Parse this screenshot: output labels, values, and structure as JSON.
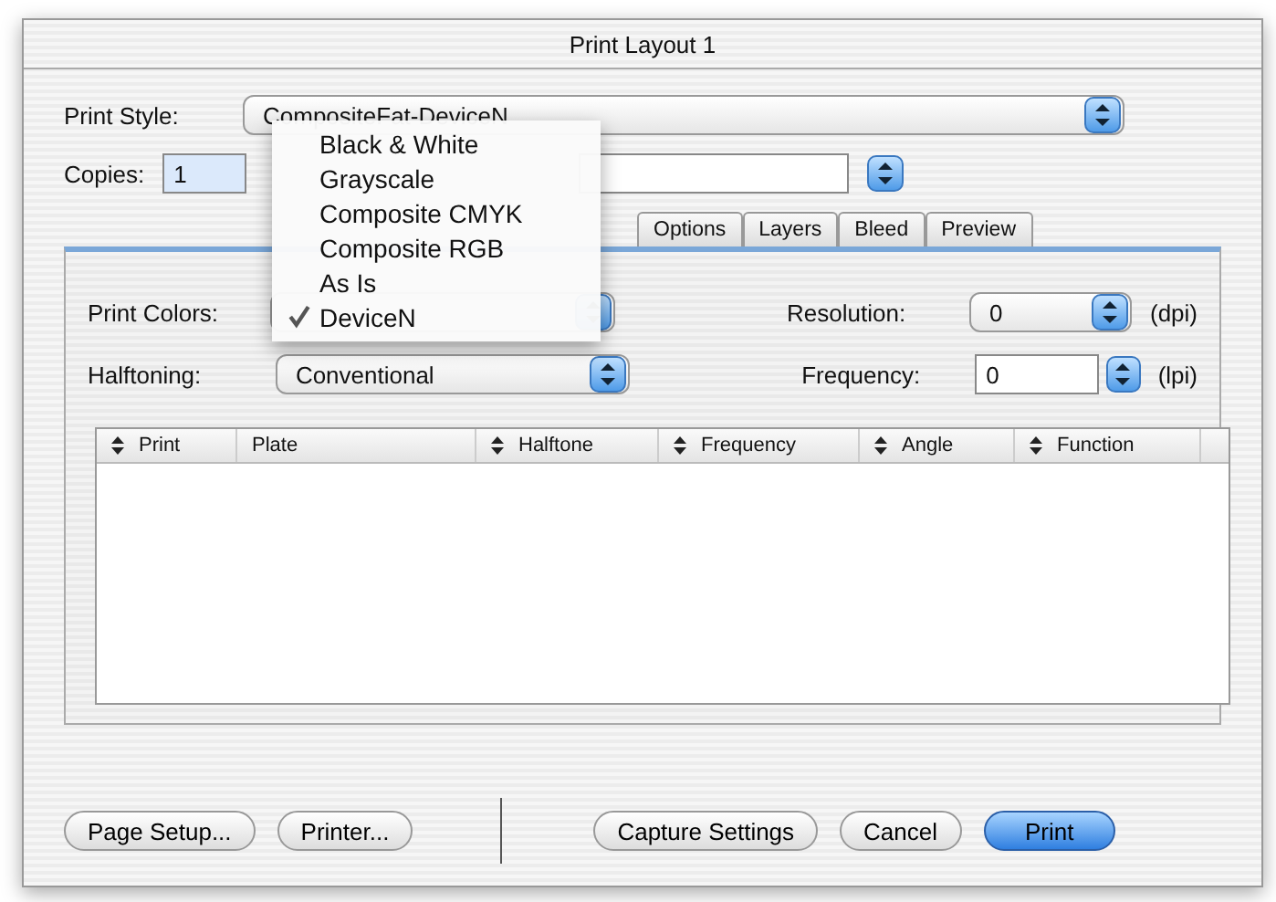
{
  "window": {
    "title": "Print Layout 1"
  },
  "print_style": {
    "label": "Print Style:",
    "value": "CompositeFat-DeviceN"
  },
  "copies": {
    "label": "Copies:",
    "value": "1"
  },
  "tabs": [
    {
      "label": "Options",
      "selected": false
    },
    {
      "label": "Layers",
      "selected": false
    },
    {
      "label": "Bleed",
      "selected": false
    },
    {
      "label": "Preview",
      "selected": false
    }
  ],
  "print_colors": {
    "label": "Print Colors:"
  },
  "halftoning": {
    "label": "Halftoning:",
    "value": "Conventional"
  },
  "resolution": {
    "label": "Resolution:",
    "value": "0",
    "unit": "(dpi)"
  },
  "frequency": {
    "label": "Frequency:",
    "value": "0",
    "unit": "(lpi)"
  },
  "table": {
    "columns": [
      {
        "label": "Print",
        "sortable": true
      },
      {
        "label": "Plate",
        "sortable": false
      },
      {
        "label": "Halftone",
        "sortable": true
      },
      {
        "label": "Frequency",
        "sortable": true
      },
      {
        "label": "Angle",
        "sortable": true
      },
      {
        "label": "Function",
        "sortable": true
      }
    ]
  },
  "buttons_left": [
    "Page Setup...",
    "Printer..."
  ],
  "buttons_right": [
    {
      "label": "Capture Settings",
      "default": false
    },
    {
      "label": "Cancel",
      "default": false
    },
    {
      "label": "Print",
      "default": true
    }
  ],
  "menu": {
    "items": [
      {
        "label": "Black & White",
        "selected": false
      },
      {
        "label": "Grayscale",
        "selected": false
      },
      {
        "label": "Composite CMYK",
        "selected": false
      },
      {
        "label": "Composite RGB",
        "selected": false
      },
      {
        "label": "As Is",
        "selected": false
      },
      {
        "label": "DeviceN",
        "selected": true
      }
    ]
  }
}
